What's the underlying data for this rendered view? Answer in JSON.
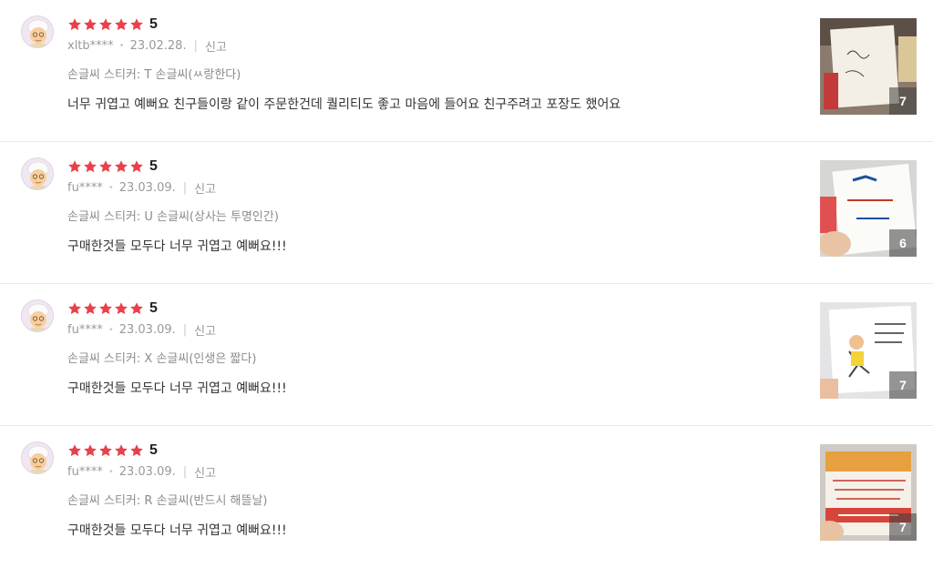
{
  "colors": {
    "star": "#e9404b",
    "text": "#333333",
    "muted": "#999999",
    "divider": "#e9e9e9"
  },
  "reviews": [
    {
      "score": "5",
      "user": "xltb****",
      "date": "23.02.28.",
      "report": "신고",
      "option": "손글씨 스티커: T 손글씨(ㅆ랑한다)",
      "content": "너무 귀엽고 예뻐요 친구들이랑 같이 주문한건데 퀄리티도 좋고 마음에 들어요  친구주려고 포장도 했어요",
      "photo_count": "7",
      "avatar_icon": "character-avatar-icon"
    },
    {
      "score": "5",
      "user": "fu****",
      "date": "23.03.09.",
      "report": "신고",
      "option": "손글씨 스티커: U 손글씨(상사는 투명인간)",
      "content": "구매한것들 모두다 너무 귀엽고 예뻐요!!!",
      "photo_count": "6",
      "avatar_icon": "character-avatar-icon"
    },
    {
      "score": "5",
      "user": "fu****",
      "date": "23.03.09.",
      "report": "신고",
      "option": "손글씨 스티커: X 손글씨(인생은 짧다)",
      "content": "구매한것들 모두다 너무 귀엽고 예뻐요!!!",
      "photo_count": "7",
      "avatar_icon": "character-avatar-icon"
    },
    {
      "score": "5",
      "user": "fu****",
      "date": "23.03.09.",
      "report": "신고",
      "option": "손글씨 스티커: R 손글씨(반드시 해뜰날)",
      "content": "구매한것들 모두다 너무 귀엽고 예뻐요!!!",
      "photo_count": "7",
      "avatar_icon": "character-avatar-icon"
    }
  ]
}
